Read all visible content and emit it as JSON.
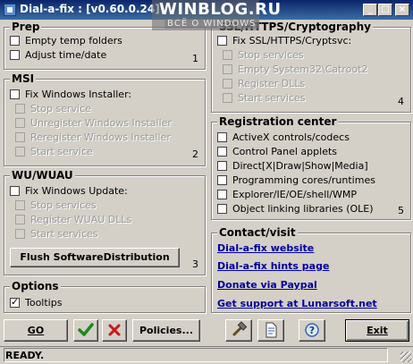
{
  "window": {
    "title": "Dial-a-fix : [v0.60.0.24]",
    "watermark": "WINBLOG.RU",
    "watermark_sub": "ВСЁ О WINDOWS",
    "minimize": "_",
    "maximize": "□",
    "close": "×"
  },
  "prep": {
    "title": "Prep",
    "items": [
      "Empty temp folders",
      "Adjust time/date"
    ],
    "number": "1"
  },
  "msi": {
    "title": "MSI",
    "main": "Fix Windows Installer:",
    "sub": [
      "Stop service",
      "Unregister Windows Installer",
      "Reregister Windows Installer",
      "Start service"
    ],
    "number": "2"
  },
  "wu": {
    "title": "WU/WUAU",
    "main": "Fix Windows Update:",
    "sub": [
      "Stop services",
      "Register WUAU DLLs",
      "Start services"
    ],
    "flush_button": "Flush SoftwareDistribution",
    "number": "3"
  },
  "options": {
    "title": "Options",
    "tooltips": "Tooltips"
  },
  "ssl": {
    "title": "SSL/HTTPS/Cryptography",
    "main": "Fix SSL/HTTPS/Cryptsvc:",
    "sub": [
      "Stop services",
      "Empty System32\\Catroot2",
      "Register DLLs",
      "Start services"
    ],
    "number": "4"
  },
  "registration": {
    "title": "Registration center",
    "items": [
      "ActiveX controls/codecs",
      "Control Panel applets",
      "Direct[X|Draw|Show|Media]",
      "Programming cores/runtimes",
      "Explorer/IE/OE/shell/WMP",
      "Object linking libraries (OLE)"
    ],
    "number": "5"
  },
  "contact": {
    "title": "Contact/visit",
    "links": [
      "Dial-a-fix website",
      "Dial-a-fix hints page",
      "Donate via Paypal",
      "Get support at Lunarsoft.net"
    ]
  },
  "toolbar": {
    "go": "GO",
    "policies": "Policies...",
    "exit": "Exit"
  },
  "status": "READY."
}
